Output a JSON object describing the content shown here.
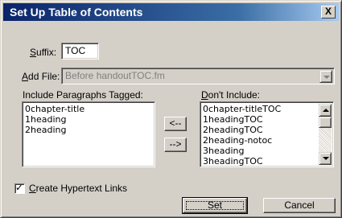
{
  "window": {
    "title": "Set Up Table of Contents",
    "close_label": "X"
  },
  "suffix": {
    "label_mnemonic": "S",
    "label_rest": "uffix:",
    "value": "TOC"
  },
  "add_file": {
    "label_mnemonic": "A",
    "label_rest": "dd File:",
    "value": "Before handoutTOC.fm"
  },
  "include": {
    "label": "Include Paragraphs Tagged:",
    "items": [
      "0chapter-title",
      "1heading",
      "2heading"
    ]
  },
  "exclude": {
    "label_mnemonic": "D",
    "label_rest": "on't Include:",
    "items": [
      "0chapter-titleTOC",
      "1headingTOC",
      "2headingTOC",
      "2heading-notoc",
      "3heading",
      "3headingTOC"
    ]
  },
  "move_left_label": "<--",
  "move_right_label": "-->",
  "hypertext": {
    "label_mnemonic": "C",
    "label_rest": "reate Hypertext Links",
    "checked": true,
    "check_glyph": "✓"
  },
  "buttons": {
    "set": "Set",
    "cancel": "Cancel"
  }
}
